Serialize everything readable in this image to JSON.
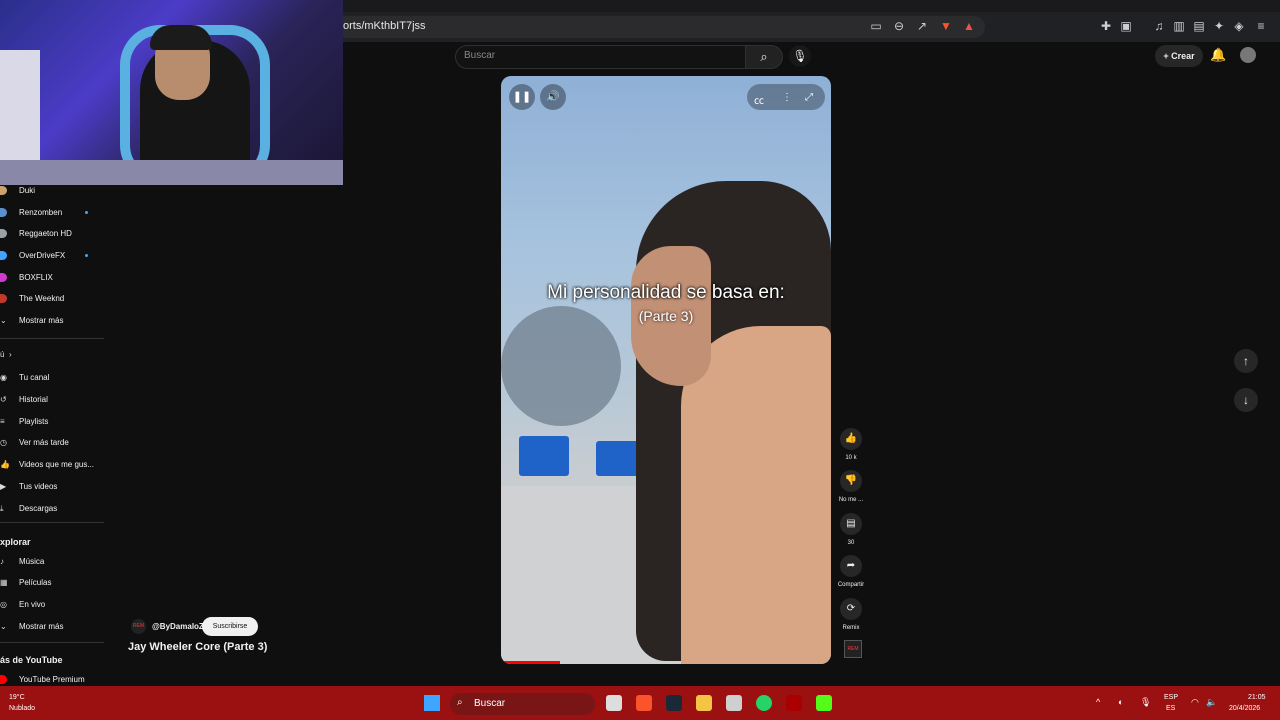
{
  "browser": {
    "url": "orts/mKthbIT7jss"
  },
  "header": {
    "search_placeholder": "Buscar",
    "create_label": "+ Crear"
  },
  "sidebar": {
    "subscriptions": [
      {
        "label": "Duki",
        "color": "#c9a36b"
      },
      {
        "label": "Renzomben",
        "color": "#5a8fd0",
        "live": true
      },
      {
        "label": "Reggaeton HD",
        "color": "#9aa0a6"
      },
      {
        "label": "OverDriveFX",
        "color": "#3ea6ff",
        "live": true
      },
      {
        "label": "BOXFLIX",
        "color": "#d03ad0"
      },
      {
        "label": "The Weeknd",
        "color": "#c0392b"
      }
    ],
    "show_more": "Mostrar más",
    "you_arrow": "›",
    "you_items": [
      "Tu canal",
      "Historial",
      "Playlists",
      "Ver más tarde",
      "Videos que me gus...",
      "Tus videos",
      "Descargas"
    ],
    "explore_heading": "xplorar",
    "explore_items": [
      "Música",
      "Películas",
      "En vivo",
      "Mostrar más"
    ],
    "more_heading": "ás de YouTube",
    "more_items": [
      "YouTube Premium"
    ]
  },
  "video": {
    "caption_line1": "Mi personalidad se basa en:",
    "caption_line2": "(Parte 3)",
    "progress": 0.18
  },
  "actions": {
    "like_count": "10 k",
    "dislike_label": "No me ...",
    "comment_count": "30",
    "share_label": "Compartir",
    "remix_label": "Remix"
  },
  "channel": {
    "name": "@ByDamaloZ",
    "subscribe_label": "Suscribirse",
    "title": "Jay Wheeler Core (Parte 3)",
    "thumb_text": "REM"
  },
  "taskbar": {
    "temperature": "19°C",
    "weather": "Nublado",
    "search_label": "Buscar",
    "lang_top": "ESP",
    "lang_bottom": "ES",
    "time": "21:05",
    "date": "20/4/2026"
  }
}
